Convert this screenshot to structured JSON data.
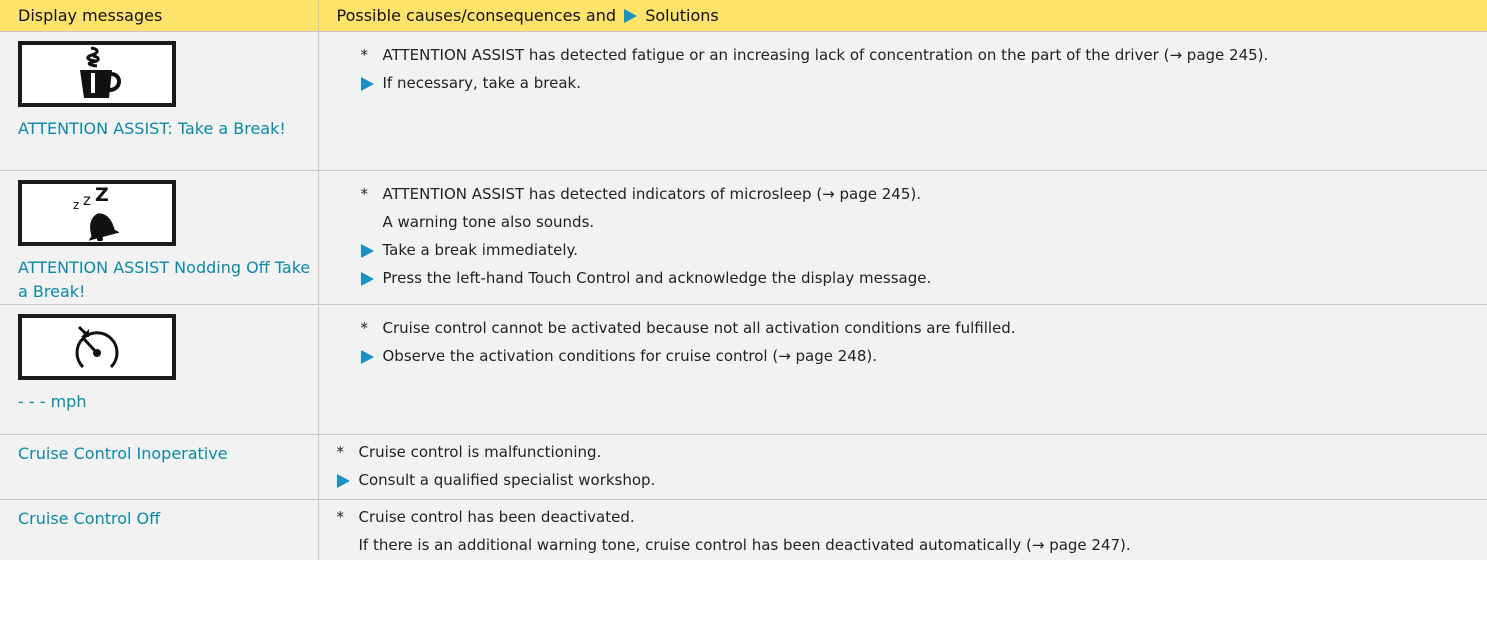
{
  "header": {
    "col1": "Display messages",
    "col2_prefix": "Possible causes/consequences and",
    "col2_suffix": "Solutions"
  },
  "rows": [
    {
      "icon": "coffee-cup-icon",
      "message": "ATTENTION ASSIST: Take a Break!",
      "cause": "ATTENTION ASSIST has detected fatigue or an increasing lack of concentration on the part of the driver (→ page 245).",
      "extra": "",
      "actions": [
        "If necessary, take a break."
      ]
    },
    {
      "icon": "sleeping-bell-icon",
      "message": "ATTENTION ASSIST Nodding Off Take a Break!",
      "cause": "ATTENTION ASSIST has detected indicators of microsleep (→ page 245).",
      "extra": "A warning tone also sounds.",
      "actions": [
        "Take a break immediately.",
        "Press the left-hand Touch Control and acknowledge the display message."
      ]
    },
    {
      "icon": "speedometer-icon",
      "message": "- - - mph",
      "cause": "Cruise control cannot be activated because not all activation conditions are fulfilled.",
      "extra": "",
      "actions": [
        "Observe the activation conditions for cruise control (→ page 248)."
      ]
    },
    {
      "icon": "",
      "message": "Cruise Control Inoperative",
      "cause": "Cruise control is malfunctioning.",
      "extra": "",
      "actions": [
        "Consult a qualified specialist workshop."
      ]
    },
    {
      "icon": "",
      "message": "Cruise Control Off",
      "cause": "Cruise control has been deactivated.",
      "extra": "If there is an additional warning tone, cruise control has been deactivated automatically (→ page 247).",
      "actions": []
    }
  ],
  "bullet_symbol": "*",
  "colors": {
    "header_bg": "#fde36a",
    "message_text": "#0a89a8",
    "solution_arrow": "#1a8fc3",
    "row_bg": "#f2f2f2"
  }
}
